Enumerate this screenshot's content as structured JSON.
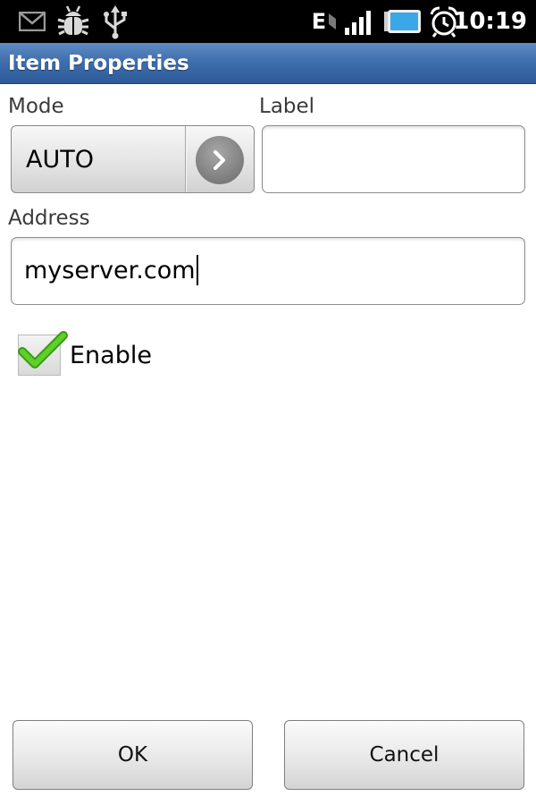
{
  "status_bar": {
    "time": "10:19",
    "network_type": "E",
    "icons": [
      "mail-icon",
      "debug-bug-icon",
      "usb-icon",
      "network-e-icon",
      "signal-icon",
      "battery-icon",
      "alarm-clock-icon"
    ]
  },
  "dialog": {
    "title": "Item Properties",
    "mode": {
      "label": "Mode",
      "value": "AUTO"
    },
    "label_field": {
      "label": "Label",
      "value": ""
    },
    "address": {
      "label": "Address",
      "value": "myserver.com"
    },
    "enable": {
      "label": "Enable",
      "checked": true
    },
    "buttons": {
      "ok": "OK",
      "cancel": "Cancel"
    }
  },
  "colors": {
    "title_bar": "#3f6fad",
    "status_bar": "#000000",
    "check": "#5fcf2a",
    "battery": "#3aa7e8"
  }
}
